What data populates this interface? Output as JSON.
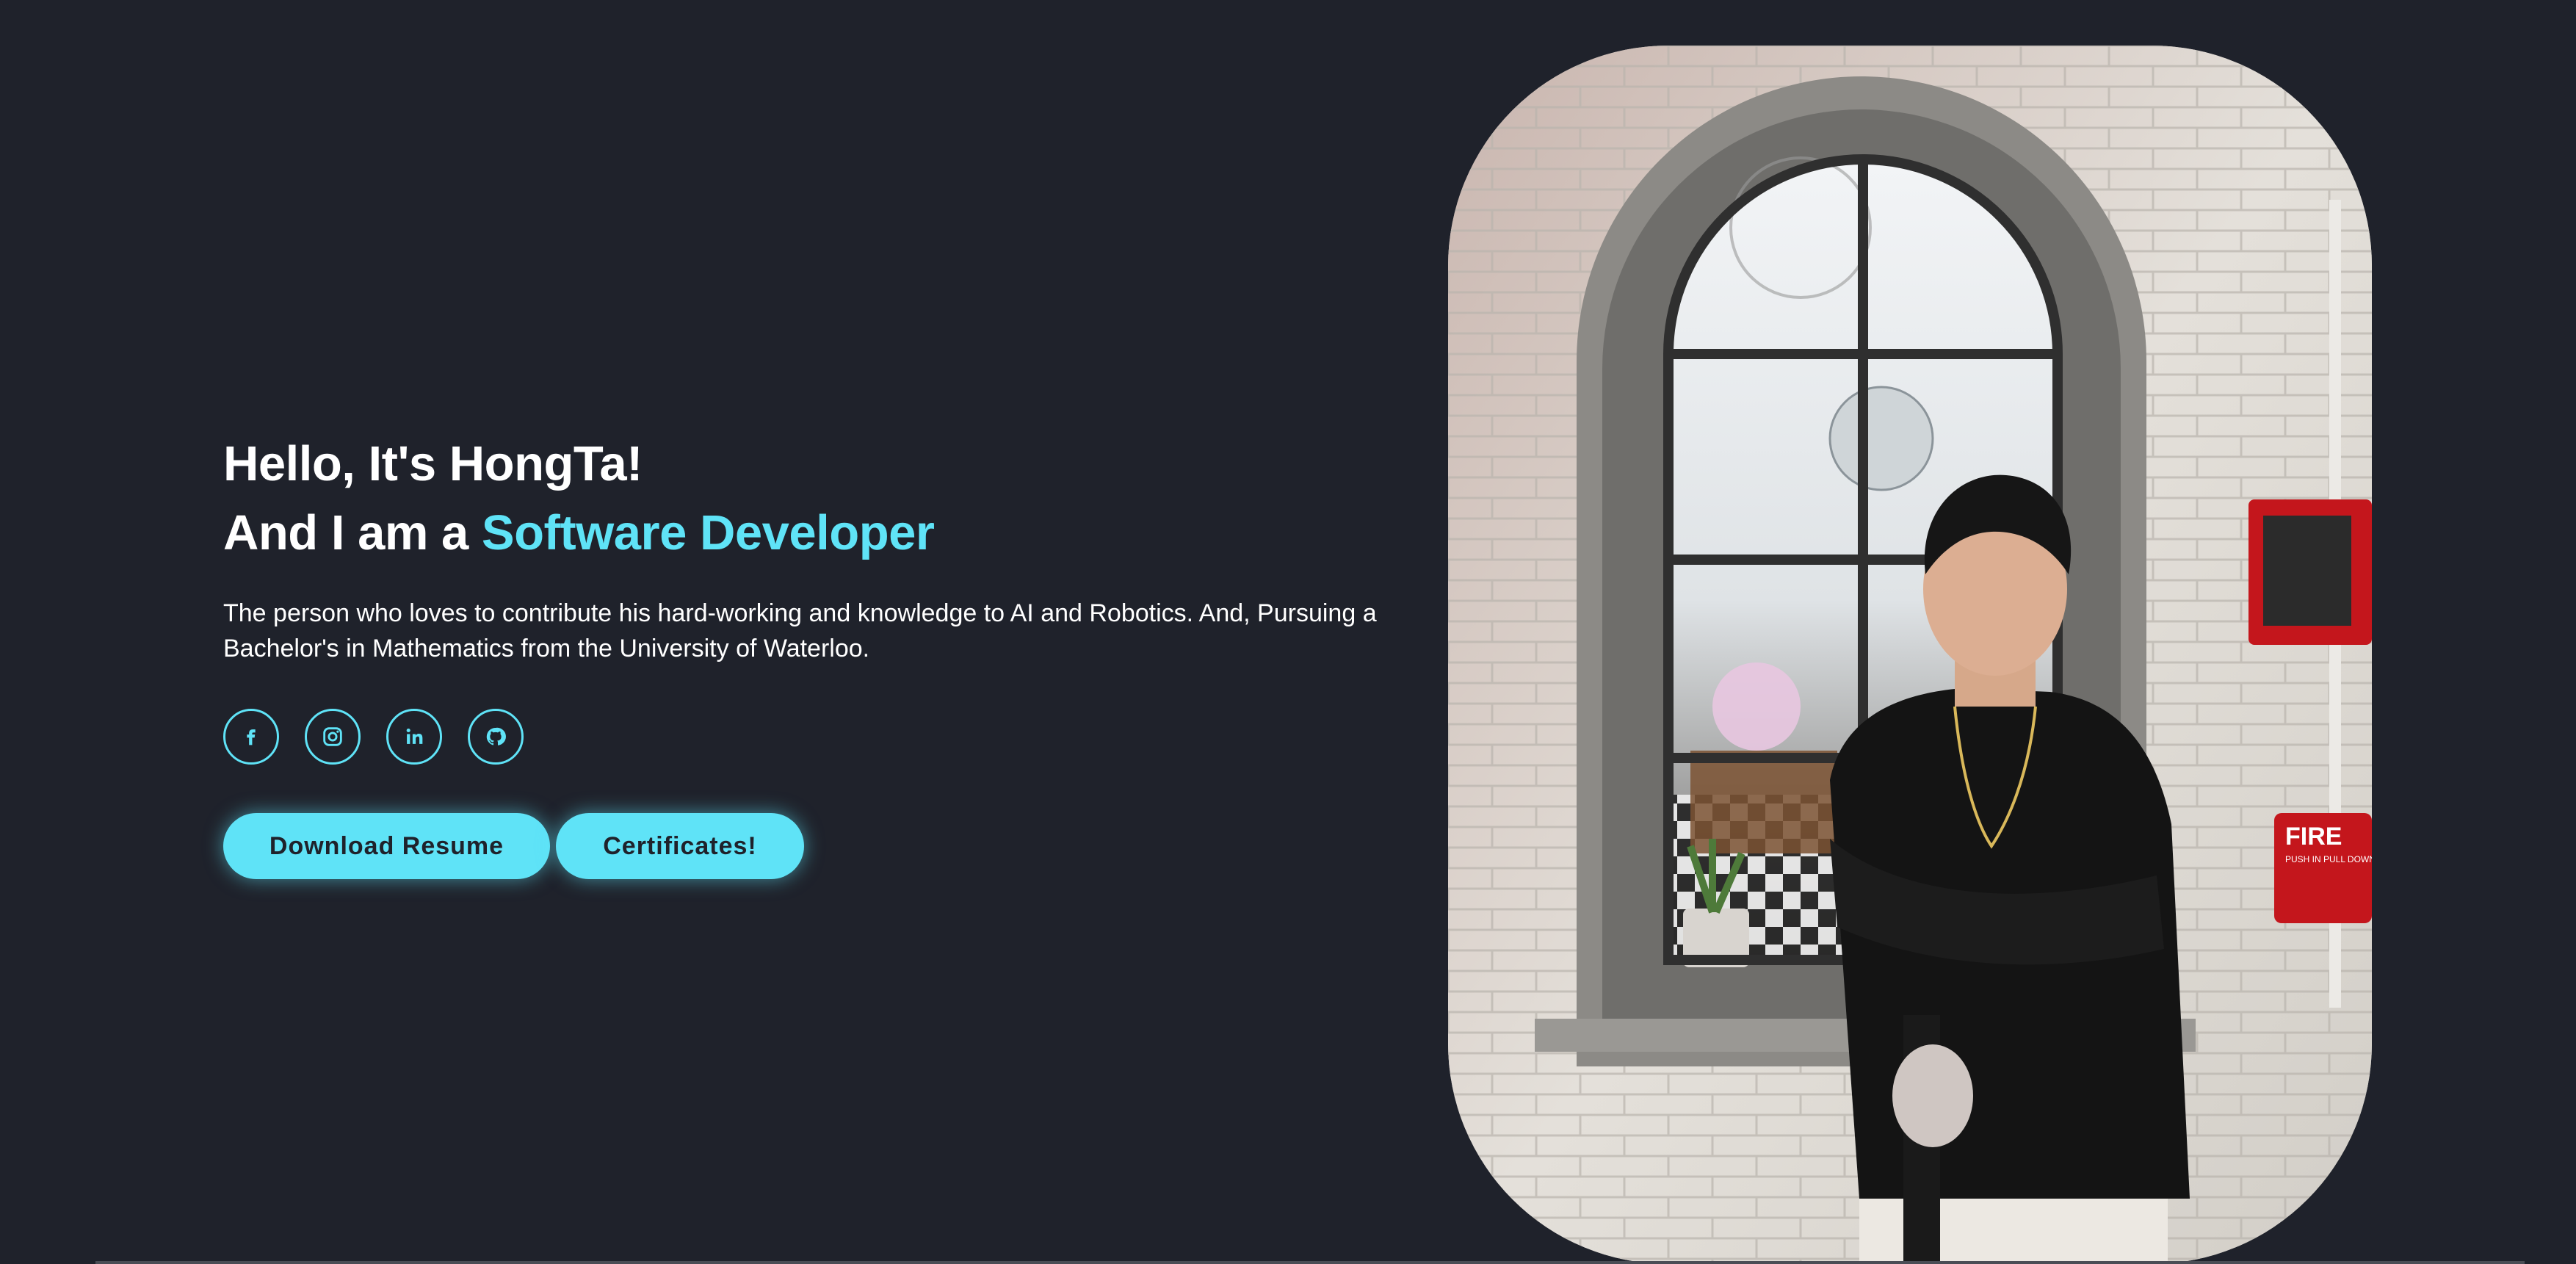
{
  "hero": {
    "greeting": "Hello, It's HongTa!",
    "title_prefix": "And I am a ",
    "title_accent": "Software Developer",
    "bio": "The person who loves to contribute his hard-working and knowledge to AI and Robotics. And, Pursuing a Bachelor's in Mathematics from the University of Waterloo."
  },
  "socials": [
    {
      "icon": "facebook-icon"
    },
    {
      "icon": "instagram-icon"
    },
    {
      "icon": "linkedin-icon"
    },
    {
      "icon": "github-icon"
    }
  ],
  "buttons": {
    "download_resume": "Download Resume",
    "certificates": "Certificates!"
  },
  "photo": {
    "sign_text": "FIRE",
    "sign_subtext": "PUSH IN PULL DOWN"
  },
  "colors": {
    "background": "#1f222b",
    "accent": "#5fe3f7",
    "text": "#ffffff"
  }
}
